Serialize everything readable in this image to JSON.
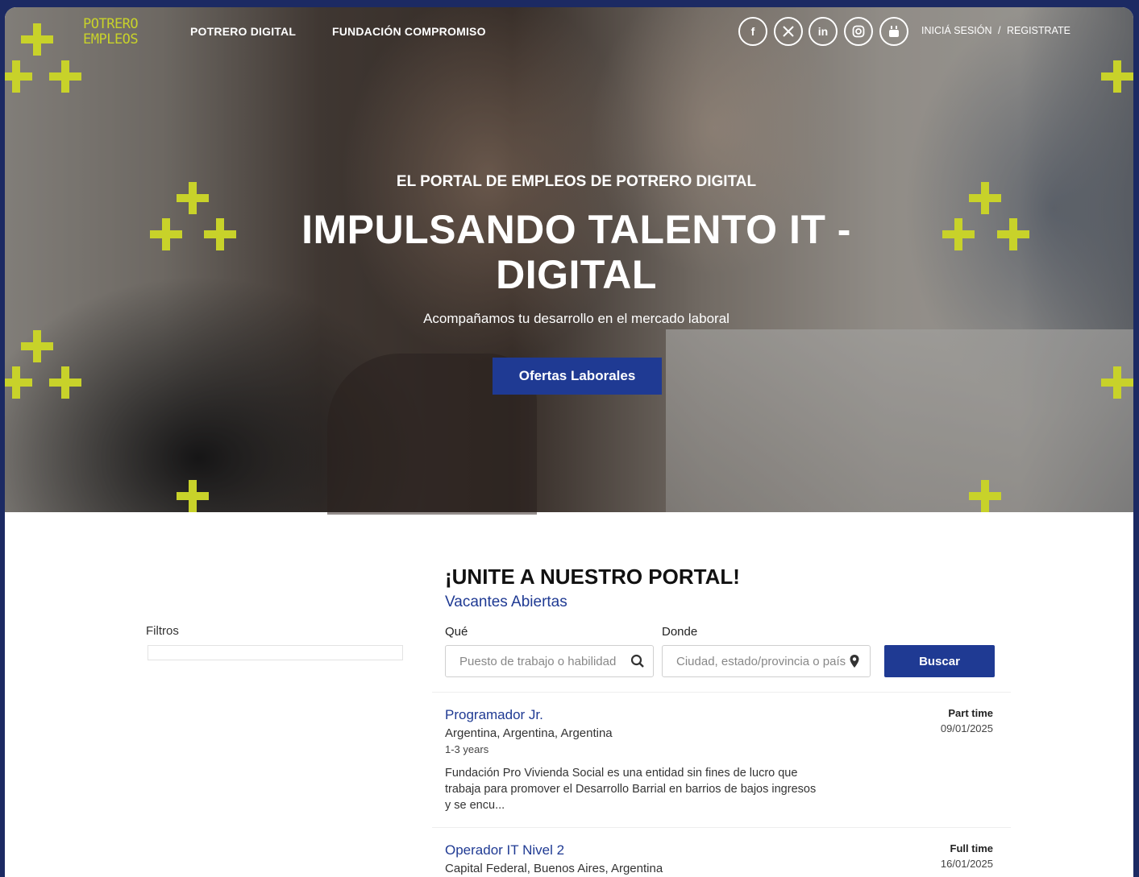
{
  "header": {
    "logo_line1": "POTRERO",
    "logo_line2": "EMPLEOS",
    "nav": [
      "POTRERO DIGITAL",
      "FUNDACIÓN COMPROMISO"
    ],
    "social_icons": [
      "facebook-icon",
      "x-icon",
      "linkedin-icon",
      "instagram-icon",
      "youtube-icon"
    ],
    "login": "INICIÁ SESIÓN",
    "separator": "/",
    "register": "REGISTRATE"
  },
  "hero": {
    "pre_title": "EL PORTAL DE EMPLEOS DE POTRERO DIGITAL",
    "title": "IMPULSANDO TALENTO IT - DIGITAL",
    "subtitle": "Acompañamos tu desarrollo en el mercado laboral",
    "cta": "Ofertas Laborales"
  },
  "filters": {
    "label": "Filtros"
  },
  "portal": {
    "title": "¡UNITE A NUESTRO PORTAL!",
    "subtitle": "Vacantes Abiertas"
  },
  "search": {
    "what_label": "Qué",
    "what_placeholder": "Puesto de trabajo o habilidad",
    "where_label": "Donde",
    "where_placeholder": "Ciudad, estado/provincia o país",
    "button": "Buscar"
  },
  "jobs": [
    {
      "title": "Programador Jr.",
      "location": "Argentina, Argentina, Argentina",
      "experience": "1-3 years",
      "description": "Fundación Pro Vivienda Social es una entidad sin fines de lucro que trabaja para promover el Desarrollo Barrial en barrios de bajos ingresos y se encu...",
      "type": "Part time",
      "date": "09/01/2025"
    },
    {
      "title": "Operador IT Nivel 2",
      "location": "Capital Federal, Buenos Aires, Argentina",
      "type": "Full time",
      "date": "16/01/2025"
    }
  ],
  "colors": {
    "accent": "#1f3a93",
    "brand_lime": "#c8d22a",
    "frame": "#1c2a63"
  }
}
